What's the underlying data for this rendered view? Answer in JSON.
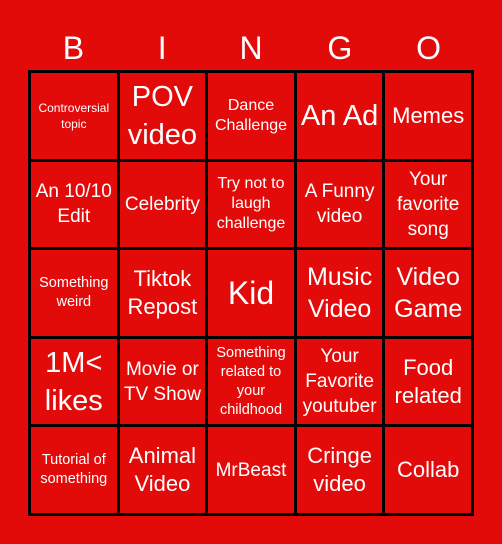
{
  "header": [
    "B",
    "I",
    "N",
    "G",
    "O"
  ],
  "cells": [
    "Controversial topic",
    "POV video",
    "Dance Challenge",
    "An Ad",
    "Memes",
    "An 10/10 Edit",
    "Celebrity",
    "Try not to laugh challenge",
    "A Funny video",
    "Your favorite song",
    "Something weird",
    "Tiktok Repost",
    "Kid",
    "Music Video",
    "Video Game",
    "1M< likes",
    "Movie or TV Show",
    "Something related to your childhood",
    "Your Favorite youtuber",
    "Food related",
    "Tutorial of something",
    "Animal Video",
    "MrBeast",
    "Cringe video",
    "Collab"
  ],
  "colors": {
    "background": "#e30a0a",
    "border": "#000000",
    "text": "#ffffff"
  }
}
